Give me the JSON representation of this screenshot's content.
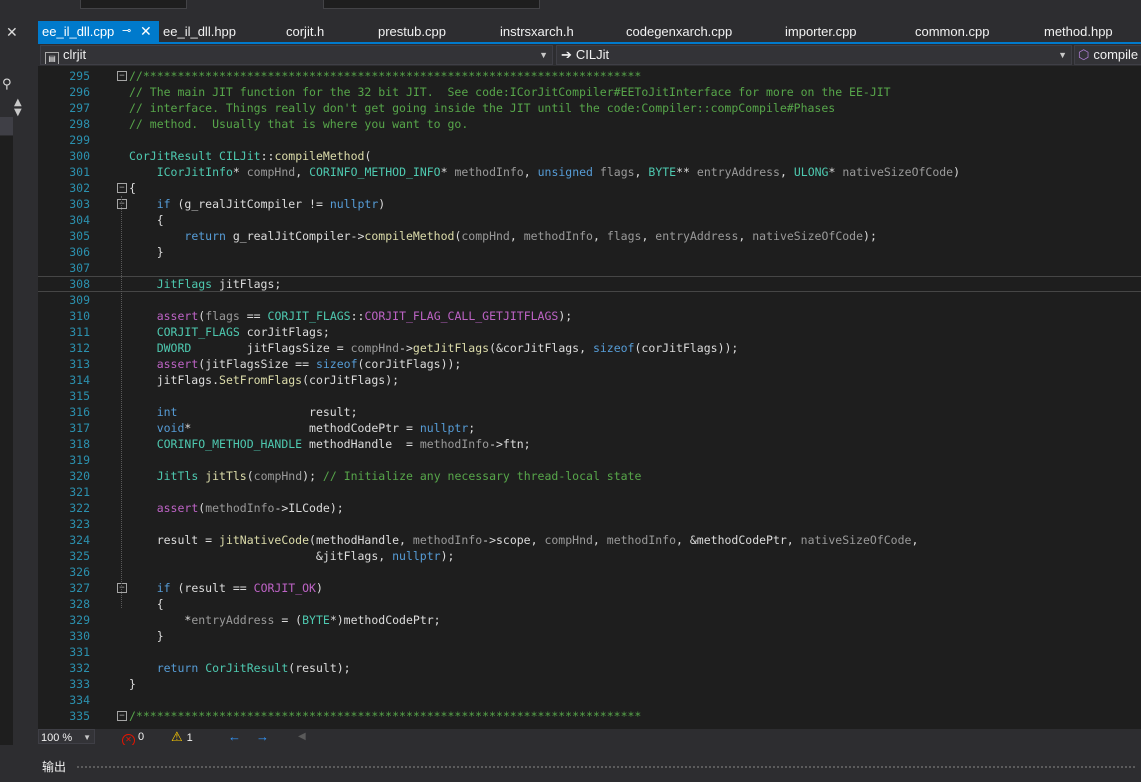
{
  "tabs": [
    {
      "label": "ee_il_dll.cpp",
      "active": true
    },
    {
      "label": "ee_il_dll.hpp"
    },
    {
      "label": "corjit.h"
    },
    {
      "label": "prestub.cpp"
    },
    {
      "label": "instrsxarch.h"
    },
    {
      "label": "codegenxarch.cpp"
    },
    {
      "label": "importer.cpp"
    },
    {
      "label": "common.cpp"
    },
    {
      "label": "method.hpp"
    }
  ],
  "navbar": {
    "project": "clrjit",
    "class": "CILJit",
    "member": "compile"
  },
  "editor": {
    "lines": [
      {
        "n": "295",
        "fold": "−",
        "html": "<span class=\"cm\">//************************************************************************</span>"
      },
      {
        "n": "296",
        "html": "<span class=\"cm\">// The main JIT function for the 32 bit JIT.  See code:ICorJitCompiler#EEToJitInterface for more on the EE-JIT</span>"
      },
      {
        "n": "297",
        "html": "<span class=\"cm\">// interface. Things really don't get going inside the JIT until the code:Compiler::compCompile#Phases</span>"
      },
      {
        "n": "298",
        "html": "<span class=\"cm\">// method.  Usually that is where you want to go.</span>"
      },
      {
        "n": "299",
        "html": ""
      },
      {
        "n": "300",
        "html": "<span class=\"ty\">CorJitResult</span> <span class=\"ty\">CILJit</span>::<span class=\"fn\">compileMethod</span>("
      },
      {
        "n": "301",
        "html": "    <span class=\"ty\">ICorJitInfo</span>* <span class=\"pr\">compHnd</span>, <span class=\"ty\">CORINFO_METHOD_INFO</span>* <span class=\"pr\">methodInfo</span>, <span class=\"kw\">unsigned</span> <span class=\"pr\">flags</span>, <span class=\"ty\">BYTE</span>** <span class=\"pr\">entryAddress</span>, <span class=\"ty\">ULONG</span>* <span class=\"pr\">nativeSizeOfCode</span>)"
      },
      {
        "n": "302",
        "fold": "−",
        "html": "{"
      },
      {
        "n": "303",
        "fold": "−",
        "html": "    <span class=\"kw\">if</span> (g_realJitCompiler != <span class=\"kw\">nullptr</span>)"
      },
      {
        "n": "304",
        "html": "    {"
      },
      {
        "n": "305",
        "html": "        <span class=\"kw\">return</span> g_realJitCompiler-><span class=\"fn\">compileMethod</span>(<span class=\"pr\">compHnd</span>, <span class=\"pr\">methodInfo</span>, <span class=\"pr\">flags</span>, <span class=\"pr\">entryAddress</span>, <span class=\"pr\">nativeSizeOfCode</span>);"
      },
      {
        "n": "306",
        "html": "    }"
      },
      {
        "n": "307",
        "html": ""
      },
      {
        "n": "308",
        "cur": true,
        "html": "    <span class=\"ty\">JitFlags</span> jitFlags;"
      },
      {
        "n": "309",
        "html": ""
      },
      {
        "n": "310",
        "html": "    <span class=\"mc\">assert</span>(<span class=\"pr\">flags</span> == <span class=\"ty\">CORJIT_FLAGS</span>::<span class=\"mc\">CORJIT_FLAG_CALL_GETJITFLAGS</span>);"
      },
      {
        "n": "311",
        "html": "    <span class=\"ty\">CORJIT_FLAGS</span> corJitFlags;"
      },
      {
        "n": "312",
        "html": "    <span class=\"ty\">DWORD</span>        jitFlagsSize = <span class=\"pr\">compHnd</span>-><span class=\"fn\">getJitFlags</span>(&amp;corJitFlags, <span class=\"kw\">sizeof</span>(corJitFlags));"
      },
      {
        "n": "313",
        "html": "    <span class=\"mc\">assert</span>(jitFlagsSize == <span class=\"kw\">sizeof</span>(corJitFlags));"
      },
      {
        "n": "314",
        "html": "    jitFlags.<span class=\"fn\">SetFromFlags</span>(corJitFlags);"
      },
      {
        "n": "315",
        "html": ""
      },
      {
        "n": "316",
        "html": "    <span class=\"kw\">int</span>                   result;"
      },
      {
        "n": "317",
        "html": "    <span class=\"kw\">void</span>*                 methodCodePtr = <span class=\"kw\">nullptr</span>;"
      },
      {
        "n": "318",
        "html": "    <span class=\"ty\">CORINFO_METHOD_HANDLE</span> methodHandle  = <span class=\"pr\">methodInfo</span>->ftn;"
      },
      {
        "n": "319",
        "html": ""
      },
      {
        "n": "320",
        "html": "    <span class=\"ty\">JitTls</span> <span class=\"fn\">jitTls</span>(<span class=\"pr\">compHnd</span>); <span class=\"cm\">// Initialize any necessary thread-local state</span>"
      },
      {
        "n": "321",
        "html": ""
      },
      {
        "n": "322",
        "html": "    <span class=\"mc\">assert</span>(<span class=\"pr\">methodInfo</span>->ILCode);"
      },
      {
        "n": "323",
        "html": ""
      },
      {
        "n": "324",
        "html": "    result = <span class=\"fn\">jitNativeCode</span>(methodHandle, <span class=\"pr\">methodInfo</span>->scope, <span class=\"pr\">compHnd</span>, <span class=\"pr\">methodInfo</span>, &amp;methodCodePtr, <span class=\"pr\">nativeSizeOfCode</span>,"
      },
      {
        "n": "325",
        "html": "                           &amp;jitFlags, <span class=\"kw\">nullptr</span>);"
      },
      {
        "n": "326",
        "html": ""
      },
      {
        "n": "327",
        "fold": "−",
        "html": "    <span class=\"kw\">if</span> (result == <span class=\"mc\">CORJIT_OK</span>)"
      },
      {
        "n": "328",
        "html": "    {"
      },
      {
        "n": "329",
        "html": "        *<span class=\"pr\">entryAddress</span> = (<span class=\"ty\">BYTE</span>*)methodCodePtr;"
      },
      {
        "n": "330",
        "html": "    }"
      },
      {
        "n": "331",
        "html": ""
      },
      {
        "n": "332",
        "html": "    <span class=\"kw\">return</span> <span class=\"ty\">CorJitResult</span>(result);"
      },
      {
        "n": "333",
        "html": "}"
      },
      {
        "n": "334",
        "html": ""
      },
      {
        "n": "335",
        "fold": "−",
        "html": "<span class=\"cm\">/*************************************************************************</span>"
      }
    ]
  },
  "status": {
    "zoom": "100 %",
    "errors": "0",
    "warnings": "1"
  },
  "output": {
    "title": "输出"
  }
}
